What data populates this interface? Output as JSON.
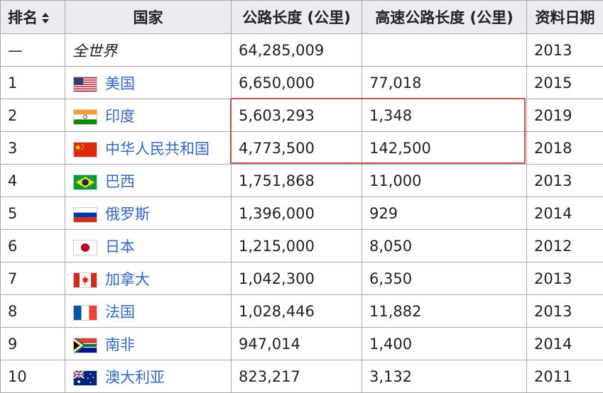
{
  "headers": {
    "rank": "排名",
    "country": "国家",
    "road_length": "公路长度 (公里)",
    "expressway_length": "高速公路长度 (公里)",
    "data_date": "资料日期"
  },
  "rows": [
    {
      "rank": "—",
      "country": "全世界",
      "road": "64,285,009",
      "expressway": "",
      "date": "2013",
      "flag": ""
    },
    {
      "rank": "1",
      "country": "美国",
      "road": "6,650,000",
      "expressway": "77,018",
      "date": "2015",
      "flag": "us-flag-icon"
    },
    {
      "rank": "2",
      "country": "印度",
      "road": "5,603,293",
      "expressway": "1,348",
      "date": "2019",
      "flag": "india-flag-icon"
    },
    {
      "rank": "3",
      "country": "中华人民共和国",
      "road": "4,773,500",
      "expressway": "142,500",
      "date": "2018",
      "flag": "china-flag-icon"
    },
    {
      "rank": "4",
      "country": "巴西",
      "road": "1,751,868",
      "expressway": "11,000",
      "date": "2013",
      "flag": "brazil-flag-icon"
    },
    {
      "rank": "5",
      "country": "俄罗斯",
      "road": "1,396,000",
      "expressway": "929",
      "date": "2014",
      "flag": "russia-flag-icon"
    },
    {
      "rank": "6",
      "country": "日本",
      "road": "1,215,000",
      "expressway": "8,050",
      "date": "2012",
      "flag": "japan-flag-icon"
    },
    {
      "rank": "7",
      "country": "加拿大",
      "road": "1,042,300",
      "expressway": "6,350",
      "date": "2013",
      "flag": "canada-flag-icon"
    },
    {
      "rank": "8",
      "country": "法国",
      "road": "1,028,446",
      "expressway": "11,882",
      "date": "2013",
      "flag": "france-flag-icon"
    },
    {
      "rank": "9",
      "country": "南非",
      "road": "947,014",
      "expressway": "1,400",
      "date": "2014",
      "flag": "south-africa-flag-icon"
    },
    {
      "rank": "10",
      "country": "澳大利亚",
      "road": "823,217",
      "expressway": "3,132",
      "date": "2011",
      "flag": "australia-flag-icon"
    }
  ],
  "colors": {
    "link": "#3366cc",
    "header_bg": "#eaecf0",
    "border": "#a2a9b1",
    "highlight": "#c0504d"
  }
}
